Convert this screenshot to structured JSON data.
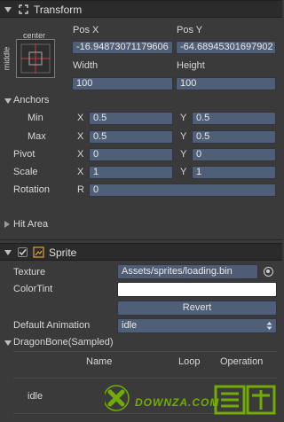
{
  "transform": {
    "title": "Transform",
    "anchor_preset": {
      "top_label": "center",
      "side_label": "middle"
    },
    "pos_x_label": "Pos X",
    "pos_y_label": "Pos Y",
    "pos_x_value": "-16.94873071179606",
    "pos_y_value": "-64.68945301697902",
    "width_label": "Width",
    "height_label": "Height",
    "width_value": "100",
    "height_value": "100",
    "anchors": {
      "title": "Anchors",
      "min_label": "Min",
      "max_label": "Max",
      "min_x": "0.5",
      "min_y": "0.5",
      "max_x": "0.5",
      "max_y": "0.5"
    },
    "pivot": {
      "label": "Pivot",
      "x": "0",
      "y": "0"
    },
    "scale": {
      "label": "Scale",
      "x": "1",
      "y": "1"
    },
    "rotation": {
      "label": "Rotation",
      "r": "0"
    },
    "axis_x": "X",
    "axis_y": "Y",
    "axis_r": "R",
    "hit_area": "Hit Area"
  },
  "sprite": {
    "title": "Sprite",
    "texture_label": "Texture",
    "texture_value": "Assets/sprites/loading.bin",
    "colortint_label": "ColorTint",
    "revert_label": "Revert",
    "default_animation_label": "Default Animation",
    "default_animation_value": "idle",
    "dragonbone_title": "DragonBone(Sampled)",
    "table": {
      "columns": [
        "Name",
        "Loop",
        "Operation"
      ],
      "rows": [
        {
          "name": "idle"
        }
      ]
    }
  },
  "watermark": {
    "text": "DOWNZA.COM"
  },
  "colors": {
    "field": "#505f78",
    "panel": "#3a3a3a",
    "header": "#2b2b2b"
  }
}
